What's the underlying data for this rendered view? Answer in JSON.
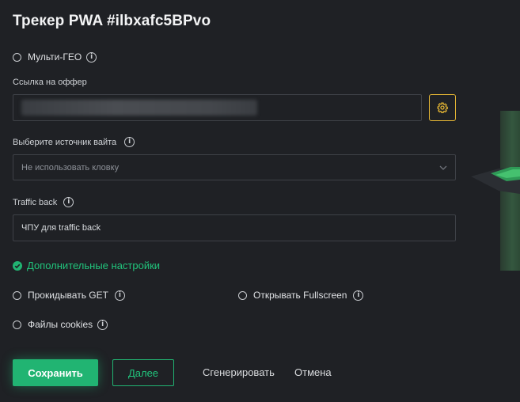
{
  "title": "Трекер PWA #ilbxafc5BPvo",
  "multi_geo": {
    "label": "Мульти-ГЕО"
  },
  "offer": {
    "label": "Ссылка на оффер",
    "value": ""
  },
  "source": {
    "label": "Выберите источник вайта",
    "placeholder": "Не использовать кловку"
  },
  "traffic_back": {
    "label": "Traffic back",
    "placeholder": "ЧПУ для traffic back"
  },
  "advanced": {
    "label": "Дополнительные настройки"
  },
  "options": {
    "forward_get": "Прокидывать GET",
    "open_fullscreen": "Открывать Fullscreen",
    "cookies": "Файлы cookies"
  },
  "actions": {
    "save": "Сохранить",
    "next": "Далее",
    "generate": "Сгенерировать",
    "cancel": "Отмена"
  },
  "colors": {
    "accent": "#21b472",
    "gear_border": "#e2b434",
    "background": "#1f2125"
  },
  "icons": [
    "info-icon",
    "gear-icon",
    "chevron-down-icon",
    "check-circle-icon"
  ]
}
